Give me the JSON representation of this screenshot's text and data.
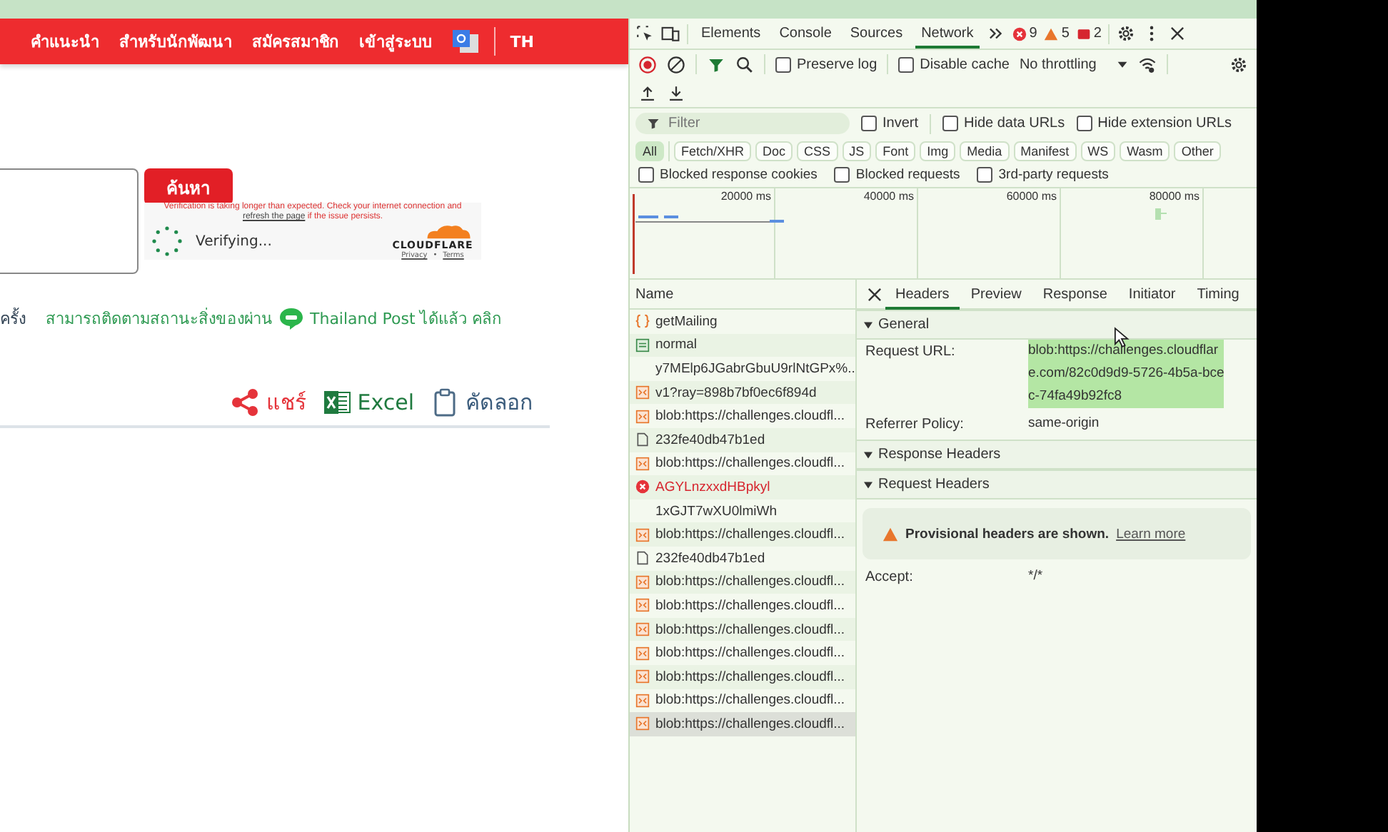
{
  "page": {
    "nav": [
      "คำแนะนำ",
      "สำหรับนักพัฒนา",
      "สมัครสมาชิก",
      "เข้าสู่ระบบ"
    ],
    "language": "TH",
    "search_button": "ค้นหา",
    "captcha": {
      "message": "Verification is taking longer than expected. Check your internet connection and",
      "link": "refresh the page",
      "message_end": "if the issue persists.",
      "status": "Verifying...",
      "brand": "CLOUDFLARE",
      "links": [
        "Privacy",
        "Terms"
      ],
      "separator": "•"
    },
    "notice": {
      "lead": "ครั้ง",
      "text": "สามารถติดตามสถานะสิ่งของผ่าน",
      "link": "Thailand Post ได้แล้ว คลิก"
    },
    "actions": [
      {
        "kind": "share",
        "label": "แชร์"
      },
      {
        "kind": "excel",
        "label": "Excel"
      },
      {
        "kind": "copy",
        "label": "คัดลอก"
      }
    ]
  },
  "devtools": {
    "tabs": [
      {
        "label": "Elements",
        "selected": false
      },
      {
        "label": "Console",
        "selected": false
      },
      {
        "label": "Sources",
        "selected": false
      },
      {
        "label": "Network",
        "selected": true
      }
    ],
    "errors": "9",
    "warnings": "5",
    "issues": "2",
    "toolbar": {
      "preserve_log": false,
      "preserve_log_label": "Preserve log",
      "disable_cache": false,
      "disable_cache_label": "Disable cache",
      "throttling": "No throttling"
    },
    "filter": {
      "placeholder": "Filter",
      "options": [
        {
          "label": "Invert",
          "checked": false
        },
        {
          "label": "Hide data URLs",
          "checked": false
        },
        {
          "label": "Hide extension URLs",
          "checked": false
        }
      ]
    },
    "types": [
      {
        "label": "All",
        "selected": true
      },
      {
        "label": "Fetch/XHR",
        "selected": false
      },
      {
        "label": "Doc",
        "selected": false
      },
      {
        "label": "CSS",
        "selected": false
      },
      {
        "label": "JS",
        "selected": false
      },
      {
        "label": "Font",
        "selected": false
      },
      {
        "label": "Img",
        "selected": false
      },
      {
        "label": "Media",
        "selected": false
      },
      {
        "label": "Manifest",
        "selected": false
      },
      {
        "label": "WS",
        "selected": false
      },
      {
        "label": "Wasm",
        "selected": false
      },
      {
        "label": "Other",
        "selected": false
      }
    ],
    "blocked": [
      {
        "label": "Blocked response cookies",
        "checked": false
      },
      {
        "label": "Blocked requests",
        "checked": false
      },
      {
        "label": "3rd-party requests",
        "checked": false
      }
    ],
    "timeline": {
      "ticks": [
        "20000 ms",
        "40000 ms",
        "60000 ms",
        "80000 ms"
      ]
    },
    "requests": {
      "header": "Name",
      "rows": [
        {
          "name": "getMailing",
          "kind": "fetch",
          "selected": false
        },
        {
          "name": "normal",
          "kind": "doc",
          "selected": false
        },
        {
          "name": "y7MElp6JGabrGbuU9rlNtGPx%...",
          "kind": "none",
          "selected": false
        },
        {
          "name": "v1?ray=898b7bf0ec6f894d",
          "kind": "script",
          "selected": false
        },
        {
          "name": "blob:https://challenges.cloudfl...",
          "kind": "script",
          "selected": false
        },
        {
          "name": "232fe40db47b1ed",
          "kind": "file",
          "selected": false
        },
        {
          "name": "blob:https://challenges.cloudfl...",
          "kind": "script",
          "selected": false
        },
        {
          "name": "AGYLnzxxdHBpkyl",
          "kind": "error",
          "selected": false
        },
        {
          "name": "1xGJT7wXU0lmiWh",
          "kind": "none",
          "selected": false
        },
        {
          "name": "blob:https://challenges.cloudfl...",
          "kind": "script",
          "selected": false
        },
        {
          "name": "232fe40db47b1ed",
          "kind": "file",
          "selected": false
        },
        {
          "name": "blob:https://challenges.cloudfl...",
          "kind": "script",
          "selected": false
        },
        {
          "name": "blob:https://challenges.cloudfl...",
          "kind": "script",
          "selected": false
        },
        {
          "name": "blob:https://challenges.cloudfl...",
          "kind": "script",
          "selected": false
        },
        {
          "name": "blob:https://challenges.cloudfl...",
          "kind": "script",
          "selected": false
        },
        {
          "name": "blob:https://challenges.cloudfl...",
          "kind": "script",
          "selected": false
        },
        {
          "name": "blob:https://challenges.cloudfl...",
          "kind": "script",
          "selected": false
        },
        {
          "name": "blob:https://challenges.cloudfl...",
          "kind": "script",
          "selected": true
        }
      ]
    },
    "detail": {
      "tabs": [
        {
          "label": "Headers",
          "selected": true
        },
        {
          "label": "Preview",
          "selected": false
        },
        {
          "label": "Response",
          "selected": false
        },
        {
          "label": "Initiator",
          "selected": false
        },
        {
          "label": "Timing",
          "selected": false
        }
      ],
      "sections": [
        {
          "title": "General",
          "expanded": true,
          "rows": [
            {
              "key": "Request URL:",
              "value": [
                "blob:https://challenges.cloudflar",
                "e.com/82c0d9d9-5726-4b5a-bce",
                "c-74fa49b92fc8"
              ],
              "highlighted": true
            },
            {
              "key": "Referrer Policy:",
              "value": [
                "same-origin"
              ],
              "highlighted": false
            }
          ]
        },
        {
          "title": "Response Headers",
          "expanded": true
        },
        {
          "title": "Request Headers",
          "expanded": true,
          "warning": {
            "text": "Provisional headers are shown.",
            "link": "Learn more"
          },
          "rows": [
            {
              "key": "Accept:",
              "value": [
                "*/*"
              ],
              "highlighted": false
            }
          ]
        }
      ]
    }
  }
}
